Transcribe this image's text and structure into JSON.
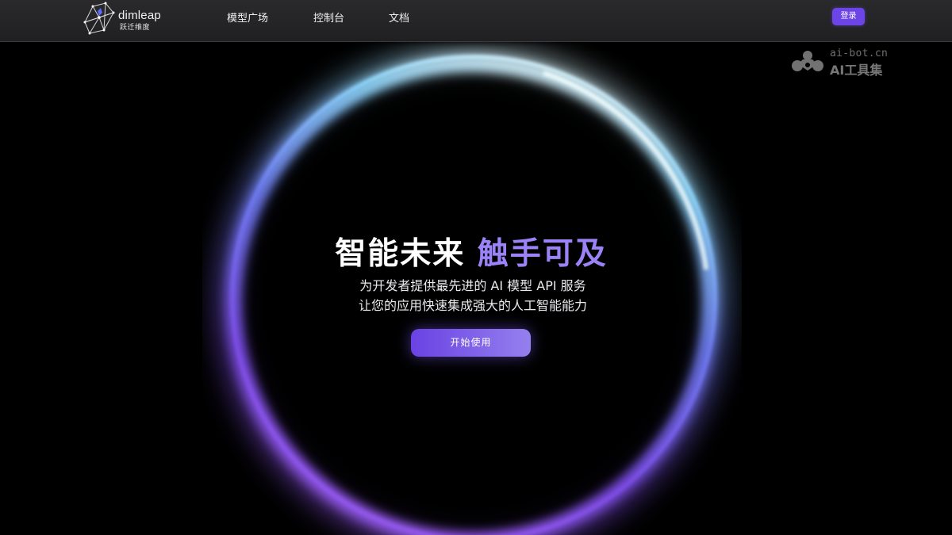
{
  "header": {
    "brand_name": "dimleap",
    "brand_sub": "跃迁维度",
    "nav": [
      "模型广场",
      "控制台",
      "文档"
    ],
    "login_label": "登录"
  },
  "watermark": {
    "url": "ai-bot.cn",
    "title": "AI工具集"
  },
  "hero": {
    "title_main": "智能未来",
    "title_accent": "触手可及",
    "subtitle_line1": "为开发者提供最先进的 AI 模型 API 服务",
    "subtitle_line2": "让您的应用快速集成强大的人工智能能力",
    "cta_label": "开始使用"
  },
  "colors": {
    "accent": "#6d45e6",
    "title_accent": "#9b82f6",
    "ring_top": "#c9f4ff",
    "ring_bottom": "#8a4df0"
  },
  "icons": [
    "dimleap-logo-icon",
    "ai-bot-logo-icon"
  ]
}
